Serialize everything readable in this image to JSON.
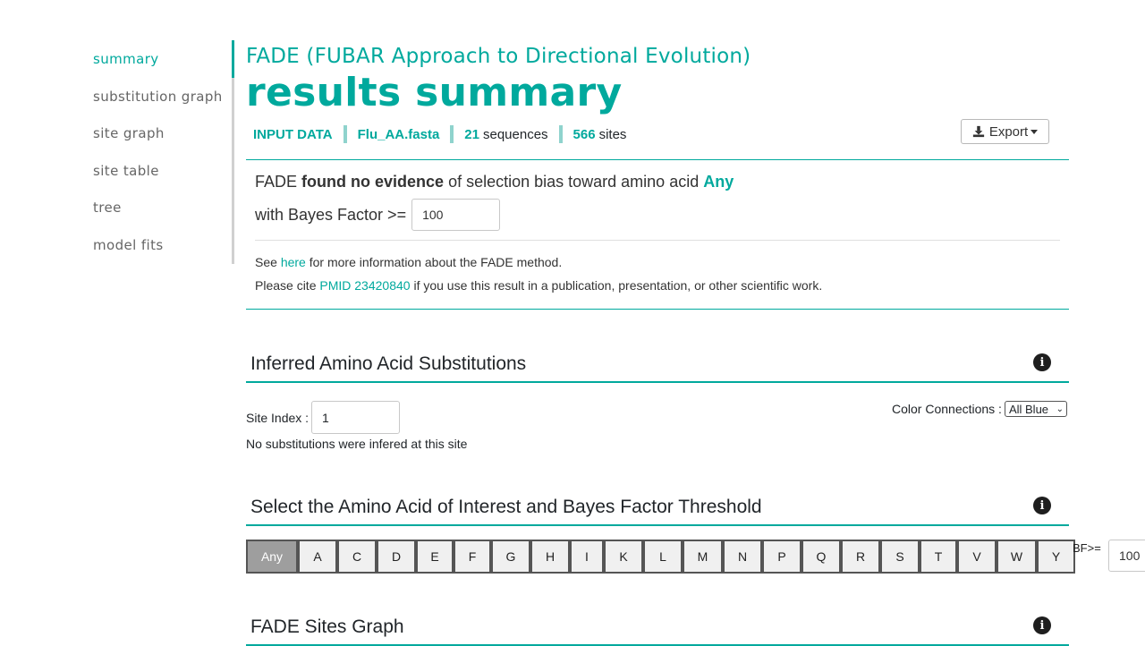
{
  "sidebar": {
    "items": [
      {
        "label": "summary",
        "active": true
      },
      {
        "label": "substitution graph"
      },
      {
        "label": "site graph"
      },
      {
        "label": "site table"
      },
      {
        "label": "tree"
      },
      {
        "label": "model fits"
      }
    ]
  },
  "header": {
    "subtitle": "FADE (FUBAR Approach to Directional Evolution)",
    "title": "results summary"
  },
  "meta": {
    "input_label": "INPUT DATA",
    "filename": "Flu_AA.fasta",
    "sequences_count": "21",
    "sequences_label": "sequences",
    "sites_count": "566",
    "sites_label": "sites"
  },
  "export": {
    "label": "Export",
    "icon": "download-icon"
  },
  "summary": {
    "prefix": "FADE",
    "emphasis": "found no evidence",
    "middle": "of selection bias toward amino acid",
    "amino_acid": "Any",
    "bf_label": "with Bayes Factor >=",
    "bf_value": "100",
    "see_prefix": "See",
    "see_link": "here",
    "see_suffix": "for more information about the FADE method.",
    "cite_prefix": "Please cite",
    "cite_link": "PMID 23420840",
    "cite_suffix": "if you use this result in a publication, presentation, or other scientific work."
  },
  "substitutions": {
    "title": "Inferred Amino Acid Substitutions",
    "site_index_label": "Site Index :",
    "site_index_value": "1",
    "color_label": "Color Connections :",
    "color_value": "All Blue",
    "no_subs_text": "No substitutions were infered at this site"
  },
  "aa_select": {
    "title": "Select the Amino Acid of Interest and Bayes Factor Threshold",
    "buttons": [
      "Any",
      "A",
      "C",
      "D",
      "E",
      "F",
      "G",
      "H",
      "I",
      "K",
      "L",
      "M",
      "N",
      "P",
      "Q",
      "R",
      "S",
      "T",
      "V",
      "W",
      "Y"
    ],
    "active": "Any",
    "bf_label": "BF>=",
    "bf_value": "100"
  },
  "sites_graph": {
    "title": "FADE Sites Graph"
  },
  "colors": {
    "accent": "#00a99d",
    "active_button": "#9e9e9e"
  }
}
